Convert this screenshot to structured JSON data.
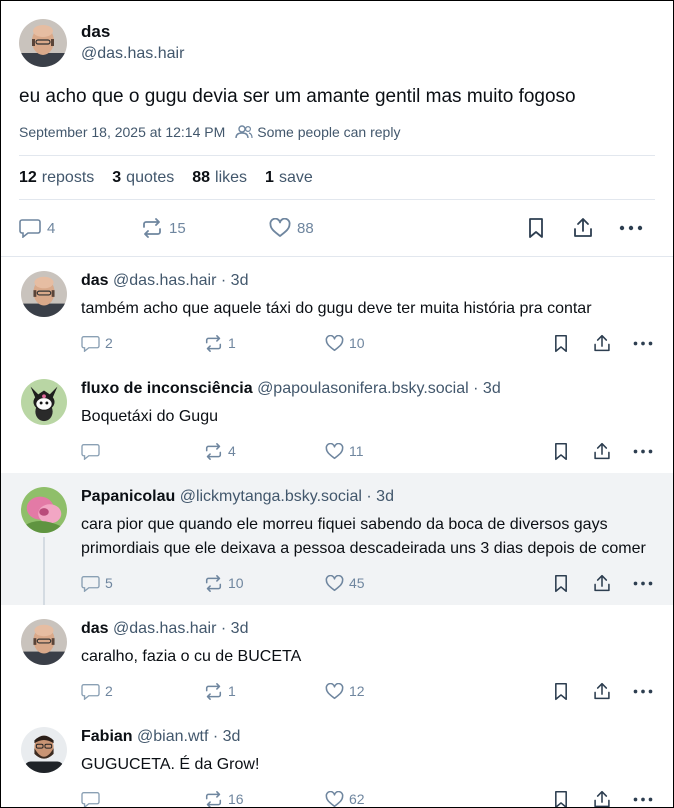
{
  "post": {
    "author_name": "das",
    "author_handle": "@das.has.hair",
    "text": "eu acho que o gugu devia ser um amante gentil mas muito fogoso",
    "timestamp": "September 18, 2025 at 12:14 PM",
    "reply_restriction": "Some people can reply",
    "stats": {
      "reposts_count": "12",
      "reposts_label": "reposts",
      "quotes_count": "3",
      "quotes_label": "quotes",
      "likes_count": "88",
      "likes_label": "likes",
      "saves_count": "1",
      "saves_label": "save"
    },
    "actions": {
      "replies": "4",
      "reposts": "15",
      "likes": "88"
    }
  },
  "replies": [
    {
      "name": "das",
      "handle": "@das.has.hair",
      "time": "· 3d",
      "text": "também acho que aquele táxi do gugu deve ter muita história pra contar",
      "replies": "2",
      "reposts": "1",
      "likes": "10",
      "avatar": "bald-man",
      "thread_below": false,
      "highlight": false
    },
    {
      "name": "fluxo de inconsciência",
      "handle": "@papoulasonifera.bsky.social",
      "time": "· 3d",
      "text": "Boquetáxi do Gugu",
      "replies": "",
      "reposts": "4",
      "likes": "11",
      "avatar": "kuromi",
      "thread_below": false,
      "highlight": false
    },
    {
      "name": "Papanicolau",
      "handle": "@lickmytanga.bsky.social",
      "time": "· 3d",
      "text": "cara pior que quando ele morreu fiquei sabendo da boca de diversos gays primordiais que ele deixava a pessoa descadeirada uns 3 dias depois de comer",
      "replies": "5",
      "reposts": "10",
      "likes": "45",
      "avatar": "pink-flower",
      "thread_below": true,
      "highlight": true
    },
    {
      "name": "das",
      "handle": "@das.has.hair",
      "time": "· 3d",
      "text": "caralho, fazia o cu de BUCETA",
      "replies": "2",
      "reposts": "1",
      "likes": "12",
      "avatar": "bald-man",
      "thread_below": false,
      "highlight": false
    },
    {
      "name": "Fabian",
      "handle": "@bian.wtf",
      "time": "· 3d",
      "text": "GUGUCETA. É da Grow!",
      "replies": "",
      "reposts": "16",
      "likes": "62",
      "avatar": "bearded-man",
      "thread_below": false,
      "highlight": false
    }
  ],
  "colors": {
    "text": "#0b0f14",
    "muted": "#42576c",
    "icon": "#6f869f",
    "border": "#e2e7ee",
    "highlight_bg": "#f1f3f5"
  }
}
